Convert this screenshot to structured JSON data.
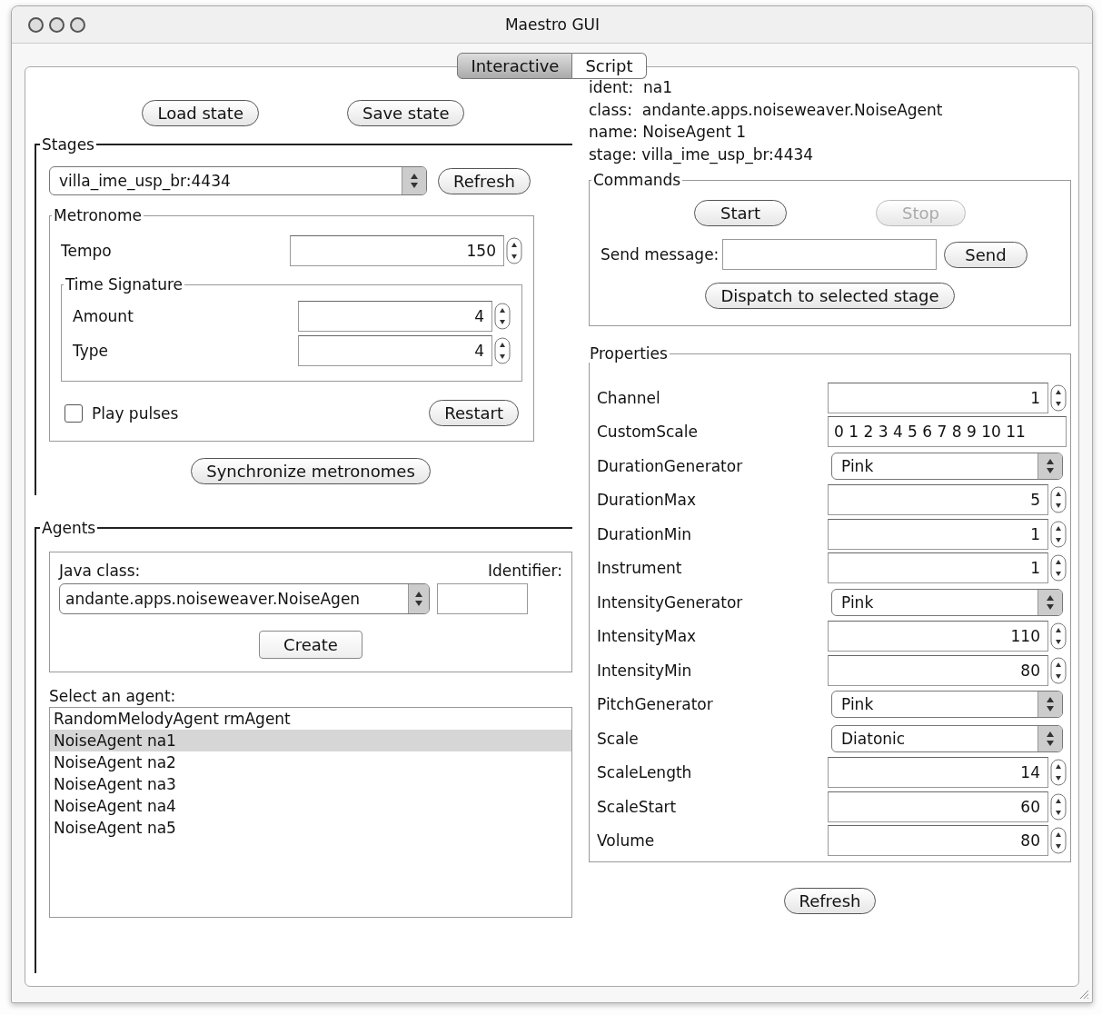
{
  "window": {
    "title": "Maestro GUI"
  },
  "tabs": [
    {
      "label": "Interactive",
      "selected": true
    },
    {
      "label": "Script",
      "selected": false
    }
  ],
  "state_buttons": [
    "Load state",
    "Save state"
  ],
  "stages": {
    "title": "Stages",
    "stage": "villa_ime_usp_br:4434",
    "refresh": "Refresh",
    "metronome": {
      "title": "Metronome",
      "tempo_label": "Tempo",
      "tempo": "150",
      "time_signature": {
        "title": "Time Signature",
        "rows": [
          {
            "label": "Amount",
            "value": "4"
          },
          {
            "label": "Type",
            "value": "4"
          }
        ]
      },
      "play_pulses": {
        "label": "Play pulses",
        "checked": false
      },
      "restart": "Restart"
    },
    "synchronize": "Synchronize metronomes"
  },
  "agents": {
    "title": "Agents",
    "java_class_label": "Java class:",
    "java_class": "andante.apps.noiseweaver.NoiseAgen",
    "identifier_label": "Identifier:",
    "create": "Create",
    "select_label": "Select an agent:",
    "items": [
      {
        "label": "RandomMelodyAgent rmAgent",
        "selected": false
      },
      {
        "label": "NoiseAgent na1",
        "selected": true
      },
      {
        "label": "NoiseAgent na2",
        "selected": false
      },
      {
        "label": "NoiseAgent na3",
        "selected": false
      },
      {
        "label": "NoiseAgent na4",
        "selected": false
      },
      {
        "label": "NoiseAgent na5",
        "selected": false
      }
    ]
  },
  "agent_info": [
    "ident:  na1",
    "class:  andante.apps.noiseweaver.NoiseAgent",
    "name: NoiseAgent 1",
    "stage: villa_ime_usp_br:4434"
  ],
  "commands": {
    "title": "Commands",
    "buttons": [
      {
        "label": "Start",
        "disabled": false
      },
      {
        "label": "Stop",
        "disabled": true
      }
    ],
    "send_label": "Send message:",
    "send": "Send",
    "dispatch": "Dispatch to selected stage"
  },
  "properties": {
    "title": "Properties",
    "rows": [
      {
        "kind": "spinner",
        "label": "Channel",
        "value": "1"
      },
      {
        "kind": "text",
        "label": "CustomScale",
        "value": "0 1 2 3 4 5 6 7 8 9 10 11"
      },
      {
        "kind": "combo",
        "label": "DurationGenerator",
        "value": "Pink"
      },
      {
        "kind": "spinner",
        "label": "DurationMax",
        "value": "5"
      },
      {
        "kind": "spinner",
        "label": "DurationMin",
        "value": "1"
      },
      {
        "kind": "spinner",
        "label": "Instrument",
        "value": "1"
      },
      {
        "kind": "combo",
        "label": "IntensityGenerator",
        "value": "Pink"
      },
      {
        "kind": "spinner",
        "label": "IntensityMax",
        "value": "110"
      },
      {
        "kind": "spinner",
        "label": "IntensityMin",
        "value": "80"
      },
      {
        "kind": "combo",
        "label": "PitchGenerator",
        "value": "Pink"
      },
      {
        "kind": "combo",
        "label": "Scale",
        "value": "Diatonic"
      },
      {
        "kind": "spinner",
        "label": "ScaleLength",
        "value": "14"
      },
      {
        "kind": "spinner",
        "label": "ScaleStart",
        "value": "60"
      },
      {
        "kind": "spinner",
        "label": "Volume",
        "value": "80"
      }
    ],
    "refresh": "Refresh"
  }
}
